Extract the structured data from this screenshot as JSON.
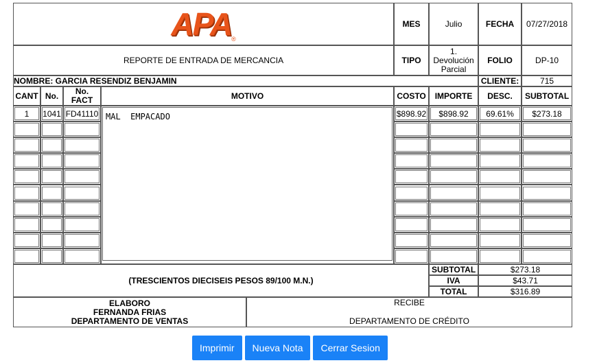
{
  "header": {
    "logo_text": "APA",
    "mes_label": "MES",
    "mes_value": "Julio",
    "fecha_label": "FECHA",
    "fecha_value": "07/27/2018",
    "report_title": "REPORTE DE ENTRADA DE MERCANCIA",
    "tipo_label": "TIPO",
    "tipo_value_1": "1.",
    "tipo_value_2": "Devolución",
    "tipo_value_3": "Parcial",
    "folio_label": "FOLIO",
    "folio_value": "DP-10",
    "nombre_label": "NOMBRE:",
    "nombre_value": "GARCIA RESENDIZ BENJAMIN",
    "cliente_label": "CLIENTE:",
    "cliente_value": "715"
  },
  "columns": {
    "cant": "CANT",
    "no": "No.",
    "nofact_1": "No.",
    "nofact_2": "FACT",
    "motivo": "MOTIVO",
    "costo": "COSTO",
    "importe": "IMPORTE",
    "desc": "DESC.",
    "subtotal": "SUBTOTAL"
  },
  "row1": {
    "cant": "1",
    "no": "1041",
    "fact": "FD41110",
    "motivo": "MAL  EMPACADO",
    "costo": "$898.92",
    "importe": "$898.92",
    "desc": "69.61%",
    "subtotal": "$273.18"
  },
  "totals": {
    "amount_words": "(TRESCIENTOS DIECISEIS PESOS 89/100 M.N.)",
    "subtotal_label": "SUBTOTAL",
    "subtotal_value": "$273.18",
    "iva_label": "IVA",
    "iva_value": "$43.71",
    "total_label": "TOTAL",
    "total_value": "$316.89"
  },
  "footer": {
    "elaboro": "ELABORO",
    "elaboro_name": "FERNANDA FRIAS",
    "elaboro_dept": "DEPARTAMENTO DE VENTAS",
    "recibe": "RECIBE",
    "recibe_dept": "DEPARTAMENTO DE CRÉDITO"
  },
  "buttons": {
    "print": "Imprimir",
    "new_note": "Nueva Nota",
    "logout": "Cerrar Sesion"
  },
  "colors": {
    "button": "#1a82f7",
    "logo": "#e8541b"
  }
}
